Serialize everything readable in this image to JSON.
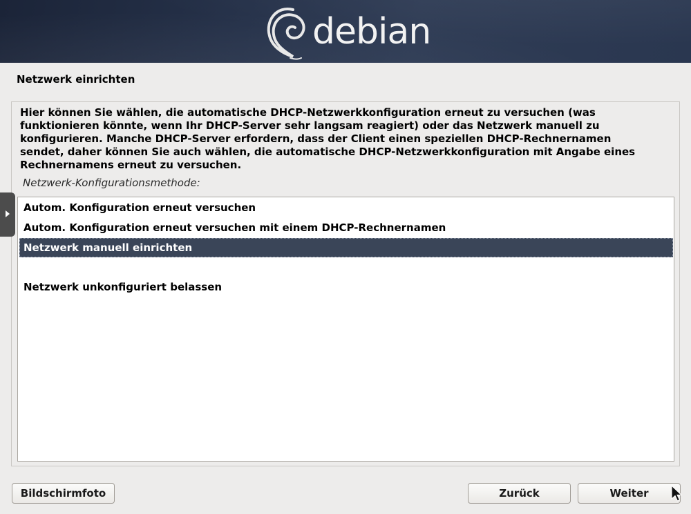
{
  "banner": {
    "logo_text": "debian"
  },
  "page_title": "Netzwerk einrichten",
  "description_lines": [
    "Hier können Sie wählen, die automatische DHCP-Netzwerkkonfiguration erneut zu versuchen (was",
    "funktionieren könnte, wenn Ihr DHCP-Server sehr langsam reagiert) oder das Netzwerk manuell zu",
    "konfigurieren. Manche DHCP-Server erfordern, dass der Client einen speziellen DHCP-Rechnernamen",
    "sendet, daher können Sie auch wählen, die automatische DHCP-Netzwerkkonfiguration mit Angabe eines",
    "Rechnernamens erneut zu versuchen."
  ],
  "question_label": "Netzwerk-Konfigurationsmethode:",
  "options": [
    {
      "label": "Autom. Konfiguration erneut versuchen",
      "selected": false
    },
    {
      "label": "Autom. Konfiguration erneut versuchen mit einem DHCP-Rechnernamen",
      "selected": false
    },
    {
      "label": "Netzwerk manuell einrichten",
      "selected": true
    },
    {
      "label": "",
      "selected": false
    },
    {
      "label": "Netzwerk unkonfiguriert belassen",
      "selected": false
    }
  ],
  "buttons": {
    "screenshot": "Bildschirmfoto",
    "back": "Zurück",
    "next": "Weiter"
  },
  "colors": {
    "banner": "#26324a",
    "selection": "#3a4558",
    "window_bg": "#edeceb"
  }
}
